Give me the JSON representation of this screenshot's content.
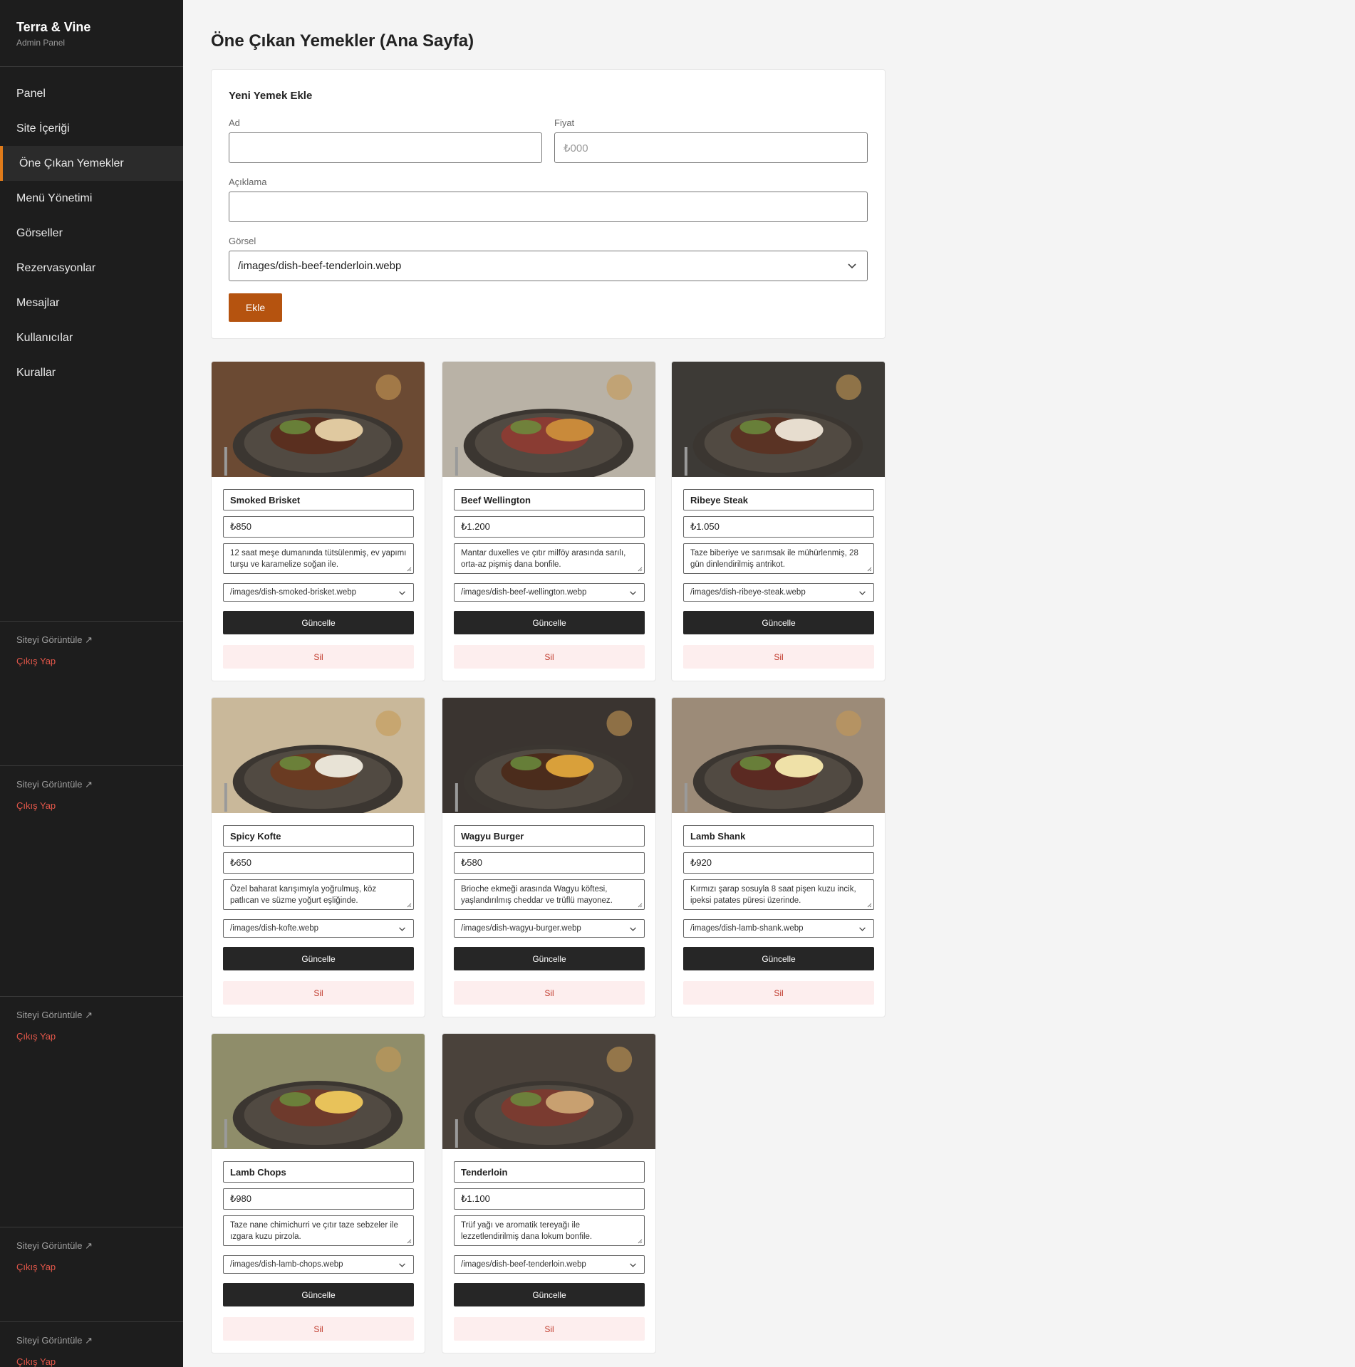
{
  "brand": {
    "name": "Terra & Vine",
    "subtitle": "Admin Panel"
  },
  "nav": [
    {
      "label": "Panel",
      "active": false
    },
    {
      "label": "Site İçeriği",
      "active": false
    },
    {
      "label": "Öne Çıkan Yemekler",
      "active": true
    },
    {
      "label": "Menü Yönetimi",
      "active": false
    },
    {
      "label": "Görseller",
      "active": false
    },
    {
      "label": "Rezervasyonlar",
      "active": false
    },
    {
      "label": "Mesajlar",
      "active": false
    },
    {
      "label": "Kullanıcılar",
      "active": false
    },
    {
      "label": "Kurallar",
      "active": false
    }
  ],
  "sidebar_footer": {
    "view_site": "Siteyi Görüntüle ↗",
    "logout": "Çıkış Yap"
  },
  "page_title": "Öne Çıkan Yemekler (Ana Sayfa)",
  "add_form": {
    "title": "Yeni Yemek Ekle",
    "name_label": "Ad",
    "name_value": "",
    "price_label": "Fiyat",
    "price_placeholder": "₺000",
    "description_label": "Açıklama",
    "description_value": "",
    "image_label": "Görsel",
    "image_selected": "/images/dish-beef-tenderloin.webp",
    "submit_label": "Ekle"
  },
  "dish_actions": {
    "update_label": "Güncelle",
    "delete_label": "Sil"
  },
  "dishes": [
    {
      "name": "Smoked Brisket",
      "price": "₺850",
      "description": "12 saat meşe dumanında tütsülenmiş, ev yapımı turşu ve karamelize soğan ile.",
      "image": "/images/dish-smoked-brisket.webp"
    },
    {
      "name": "Beef Wellington",
      "price": "₺1.200",
      "description": "Mantar duxelles ve çıtır milföy arasında sarılı, orta-az pişmiş dana bonfile.",
      "image": "/images/dish-beef-wellington.webp"
    },
    {
      "name": "Ribeye Steak",
      "price": "₺1.050",
      "description": "Taze biberiye ve sarımsak ile mühürlenmiş, 28 gün dinlendirilmiş antrikot.",
      "image": "/images/dish-ribeye-steak.webp"
    },
    {
      "name": "Spicy Kofte",
      "price": "₺650",
      "description": "Özel baharat karışımıyla yoğrulmuş, köz patlıcan ve süzme yoğurt eşliğinde.",
      "image": "/images/dish-kofte.webp"
    },
    {
      "name": "Wagyu Burger",
      "price": "₺580",
      "description": "Brioche ekmeği arasında Wagyu köftesi, yaşlandırılmış cheddar ve trüflü mayonez.",
      "image": "/images/dish-wagyu-burger.webp"
    },
    {
      "name": "Lamb Shank",
      "price": "₺920",
      "description": "Kırmızı şarap sosuyla 8 saat pişen kuzu incik, ipeksi patates püresi üzerinde.",
      "image": "/images/dish-lamb-shank.webp"
    },
    {
      "name": "Lamb Chops",
      "price": "₺980",
      "description": "Taze nane chimichurri ve çıtır taze sebzeler ile ızgara kuzu pirzola.",
      "image": "/images/dish-lamb-chops.webp"
    },
    {
      "name": "Tenderloin",
      "price": "₺1.100",
      "description": "Trüf yağı ve aromatik tereyağı ile lezzetlendirilmiş dana lokum bonfile.",
      "image": "/images/dish-beef-tenderloin.webp"
    }
  ],
  "colors": {
    "accent": "#e07b1a",
    "add_button": "#b5530f",
    "sidebar": "#1d1d1d",
    "logout": "#e4574a",
    "delete_bg": "#fdeeee",
    "delete_text": "#c0392b"
  }
}
